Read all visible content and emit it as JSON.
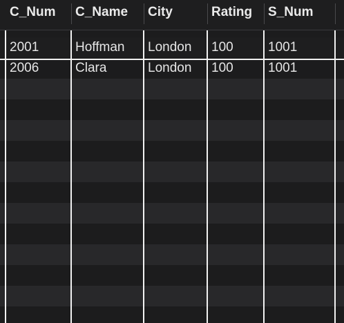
{
  "table": {
    "columns": [
      "C_Num",
      "C_Name",
      "City",
      "Rating",
      "S_Num"
    ],
    "rows": [
      [
        "2001",
        "Hoffman",
        "London",
        "100",
        "1001"
      ],
      [
        "2006",
        "Clara",
        "London",
        "100",
        "1001"
      ]
    ]
  }
}
